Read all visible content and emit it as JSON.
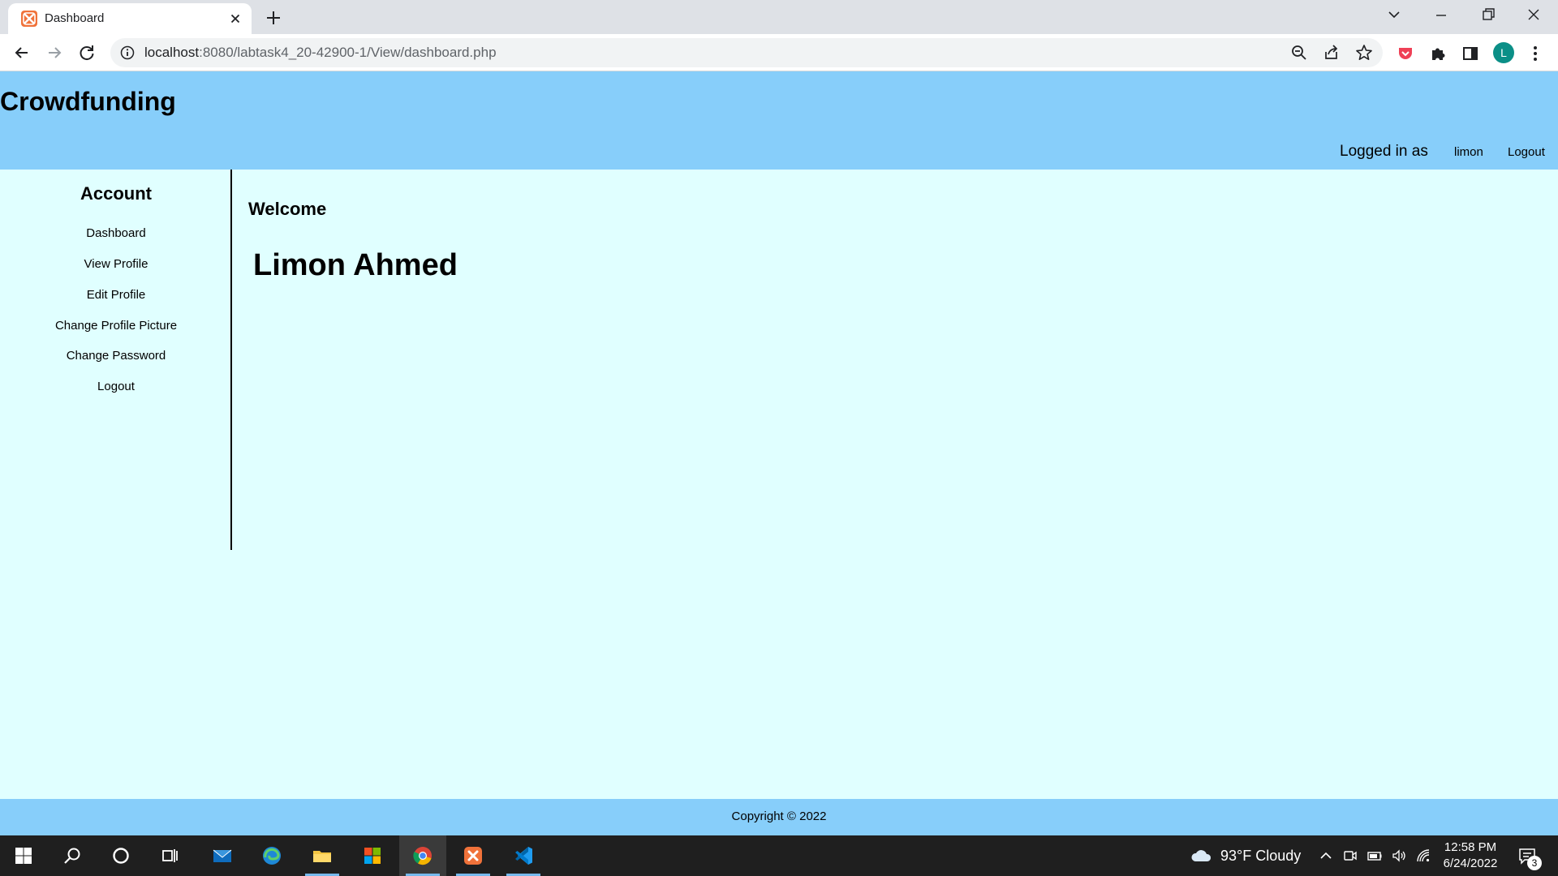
{
  "browser": {
    "tab_title": "Dashboard",
    "url_host": "localhost",
    "url_path": ":8080/labtask4_20-42900-1/View/dashboard.php",
    "profile_initial": "L"
  },
  "header": {
    "site_title": "Crowdfunding",
    "logged_in_label": "Logged in as",
    "username": "limon",
    "logout_label": "Logout"
  },
  "sidebar": {
    "heading": "Account",
    "items": [
      {
        "label": "Dashboard"
      },
      {
        "label": "View Profile"
      },
      {
        "label": "Edit Profile"
      },
      {
        "label": "Change Profile Picture"
      },
      {
        "label": "Change Password"
      },
      {
        "label": "Logout"
      }
    ]
  },
  "main": {
    "welcome": "Welcome",
    "full_name": "Limon Ahmed"
  },
  "footer": {
    "copyright": "Copyright © 2022"
  },
  "taskbar": {
    "apps": [
      "windows-start",
      "search",
      "cortana",
      "task-view",
      "mail",
      "edge",
      "file-explorer",
      "microsoft-store",
      "chrome",
      "xampp",
      "vscode"
    ],
    "weather": "93°F  Cloudy",
    "time": "12:58 PM",
    "date": "6/24/2022",
    "notification_count": "3"
  },
  "colors": {
    "header_bg": "#87cefa",
    "page_bg": "#e0ffff",
    "footer_bg": "#87cefa",
    "xampp_orange": "#f0723a",
    "profile_teal": "#0b8f87"
  }
}
